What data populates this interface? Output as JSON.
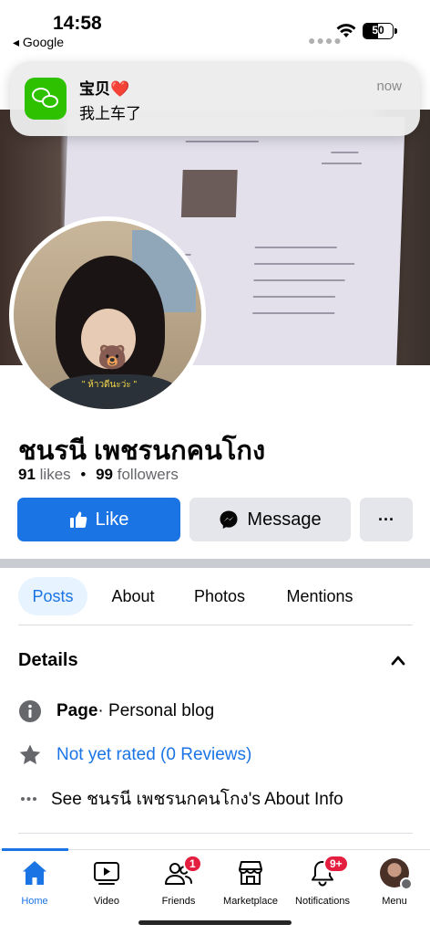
{
  "status_bar": {
    "time": "14:58",
    "back_label": "◂ Google",
    "battery": "50"
  },
  "notification": {
    "app_icon": "wechat-icon",
    "title": "宝贝❤️",
    "body": "我上车了",
    "time": "now"
  },
  "profile": {
    "name": "ชนรนี เพชรนกคนโกง",
    "likes_count": "91",
    "likes_label": "likes",
    "followers_count": "99",
    "followers_label": "followers",
    "avatar_caption": "\" ห้าวดีนะว่ะ \""
  },
  "actions": {
    "like": "Like",
    "message": "Message",
    "more": "···"
  },
  "tabs": [
    {
      "label": "Posts",
      "active": true
    },
    {
      "label": "About"
    },
    {
      "label": "Photos"
    },
    {
      "label": "Mentions"
    }
  ],
  "details": {
    "title": "Details",
    "page_label": "Page",
    "page_category": " · Personal blog",
    "rating": "Not yet rated (0 Reviews)",
    "about_link": "See ชนรนี เพชรนกคนโกง's About Info"
  },
  "bottom_nav": [
    {
      "label": "Home",
      "icon": "home-icon",
      "active": true
    },
    {
      "label": "Video",
      "icon": "video-icon"
    },
    {
      "label": "Friends",
      "icon": "friends-icon",
      "badge": "1"
    },
    {
      "label": "Marketplace",
      "icon": "marketplace-icon"
    },
    {
      "label": "Notifications",
      "icon": "bell-icon",
      "badge": "9+"
    },
    {
      "label": "Menu",
      "icon": "menu-avatar-icon"
    }
  ],
  "colors": {
    "accent": "#1b74e4",
    "badge": "#e41e3f",
    "secondary_button": "#e4e6eb",
    "muted_text": "#65676b"
  }
}
